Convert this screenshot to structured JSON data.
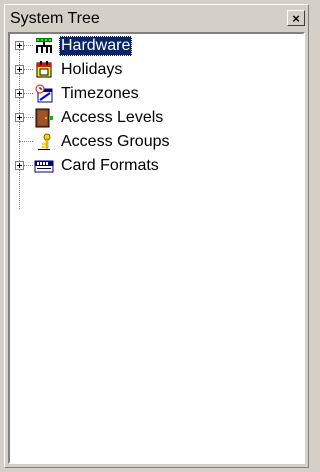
{
  "window": {
    "title": "System Tree",
    "close_symbol": "×"
  },
  "tree": {
    "items": [
      {
        "label": "Hardware",
        "icon": "hardware-icon",
        "expandable": true,
        "selected": true
      },
      {
        "label": "Holidays",
        "icon": "calendar-icon",
        "expandable": true,
        "selected": false
      },
      {
        "label": "Timezones",
        "icon": "clock-calendar-icon",
        "expandable": true,
        "selected": false
      },
      {
        "label": "Access Levels",
        "icon": "door-icon",
        "expandable": true,
        "selected": false
      },
      {
        "label": "Access Groups",
        "icon": "key-icon",
        "expandable": false,
        "selected": false
      },
      {
        "label": "Card Formats",
        "icon": "card-icon",
        "expandable": true,
        "selected": false
      }
    ]
  },
  "colors": {
    "selection": "#0a246a",
    "panel": "#d4d0c8"
  }
}
